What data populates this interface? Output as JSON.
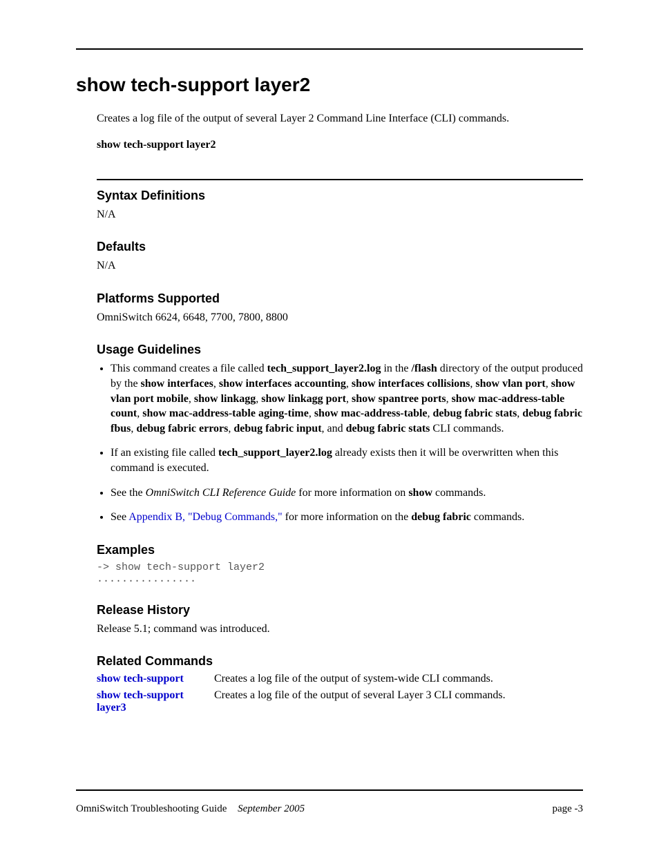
{
  "title": "show tech-support layer2",
  "intro": "Creates a log file of the output of several Layer 2 Command Line Interface (CLI) commands.",
  "syntax_line": "show tech-support layer2",
  "sections": {
    "syntax_def": {
      "heading": "Syntax Definitions",
      "body": "N/A"
    },
    "defaults": {
      "heading": "Defaults",
      "body": "N/A"
    },
    "platforms": {
      "heading": "Platforms Supported",
      "body": "OmniSwitch 6624, 6648, 7700, 7800, 8800"
    },
    "usage": {
      "heading": "Usage Guidelines"
    },
    "examples": {
      "heading": "Examples"
    },
    "release": {
      "heading": "Release History",
      "body": "Release 5.1; command was introduced."
    },
    "related": {
      "heading": "Related Commands"
    }
  },
  "usage_items": {
    "item1": {
      "pre": "This command creates a file called ",
      "file": "tech_support_layer2.log",
      "mid": " in the ",
      "dir": "/flash",
      "post": " directory of the output produced by the ",
      "cmds": [
        "show interfaces",
        "show interfaces accounting",
        "show interfaces collisions",
        "show vlan port",
        "show vlan port mobile",
        "show linkagg",
        "show linkagg port",
        "show spantree ports",
        "show mac-address-table count",
        "show mac-address-table aging-time",
        "show mac-address-table",
        "debug fabric stats",
        "debug fabric fbus",
        "debug fabric errors",
        "debug fabric input"
      ],
      "and": ", and ",
      "last_cmd": "debug fabric stats",
      "tail": " CLI commands."
    },
    "item2": {
      "pre": "If an existing file called ",
      "file": "tech_support_layer2.log",
      "post": " already exists then it will be overwritten when this command is executed."
    },
    "item3": {
      "pre": "See the ",
      "doc": "OmniSwitch CLI Reference Guide",
      "mid": " for more information on ",
      "cmd": "show",
      "post": " commands."
    },
    "item4": {
      "pre": "See ",
      "link": "Appendix B, \"Debug Commands,\"",
      "mid": " for more information on the ",
      "cmd": "debug fabric",
      "post": " commands."
    }
  },
  "example_lines": {
    "line1": "-> show tech-support layer2",
    "line2": "................"
  },
  "related_commands": [
    {
      "cmd": "show tech-support",
      "desc": "Creates a log file of the output of system-wide CLI commands."
    },
    {
      "cmd": "show tech-support layer3",
      "desc": "Creates a log file of the output of several Layer 3 CLI commands."
    }
  ],
  "footer": {
    "guide": "OmniSwitch Troubleshooting Guide",
    "date": "September 2005",
    "page": "page -3"
  }
}
